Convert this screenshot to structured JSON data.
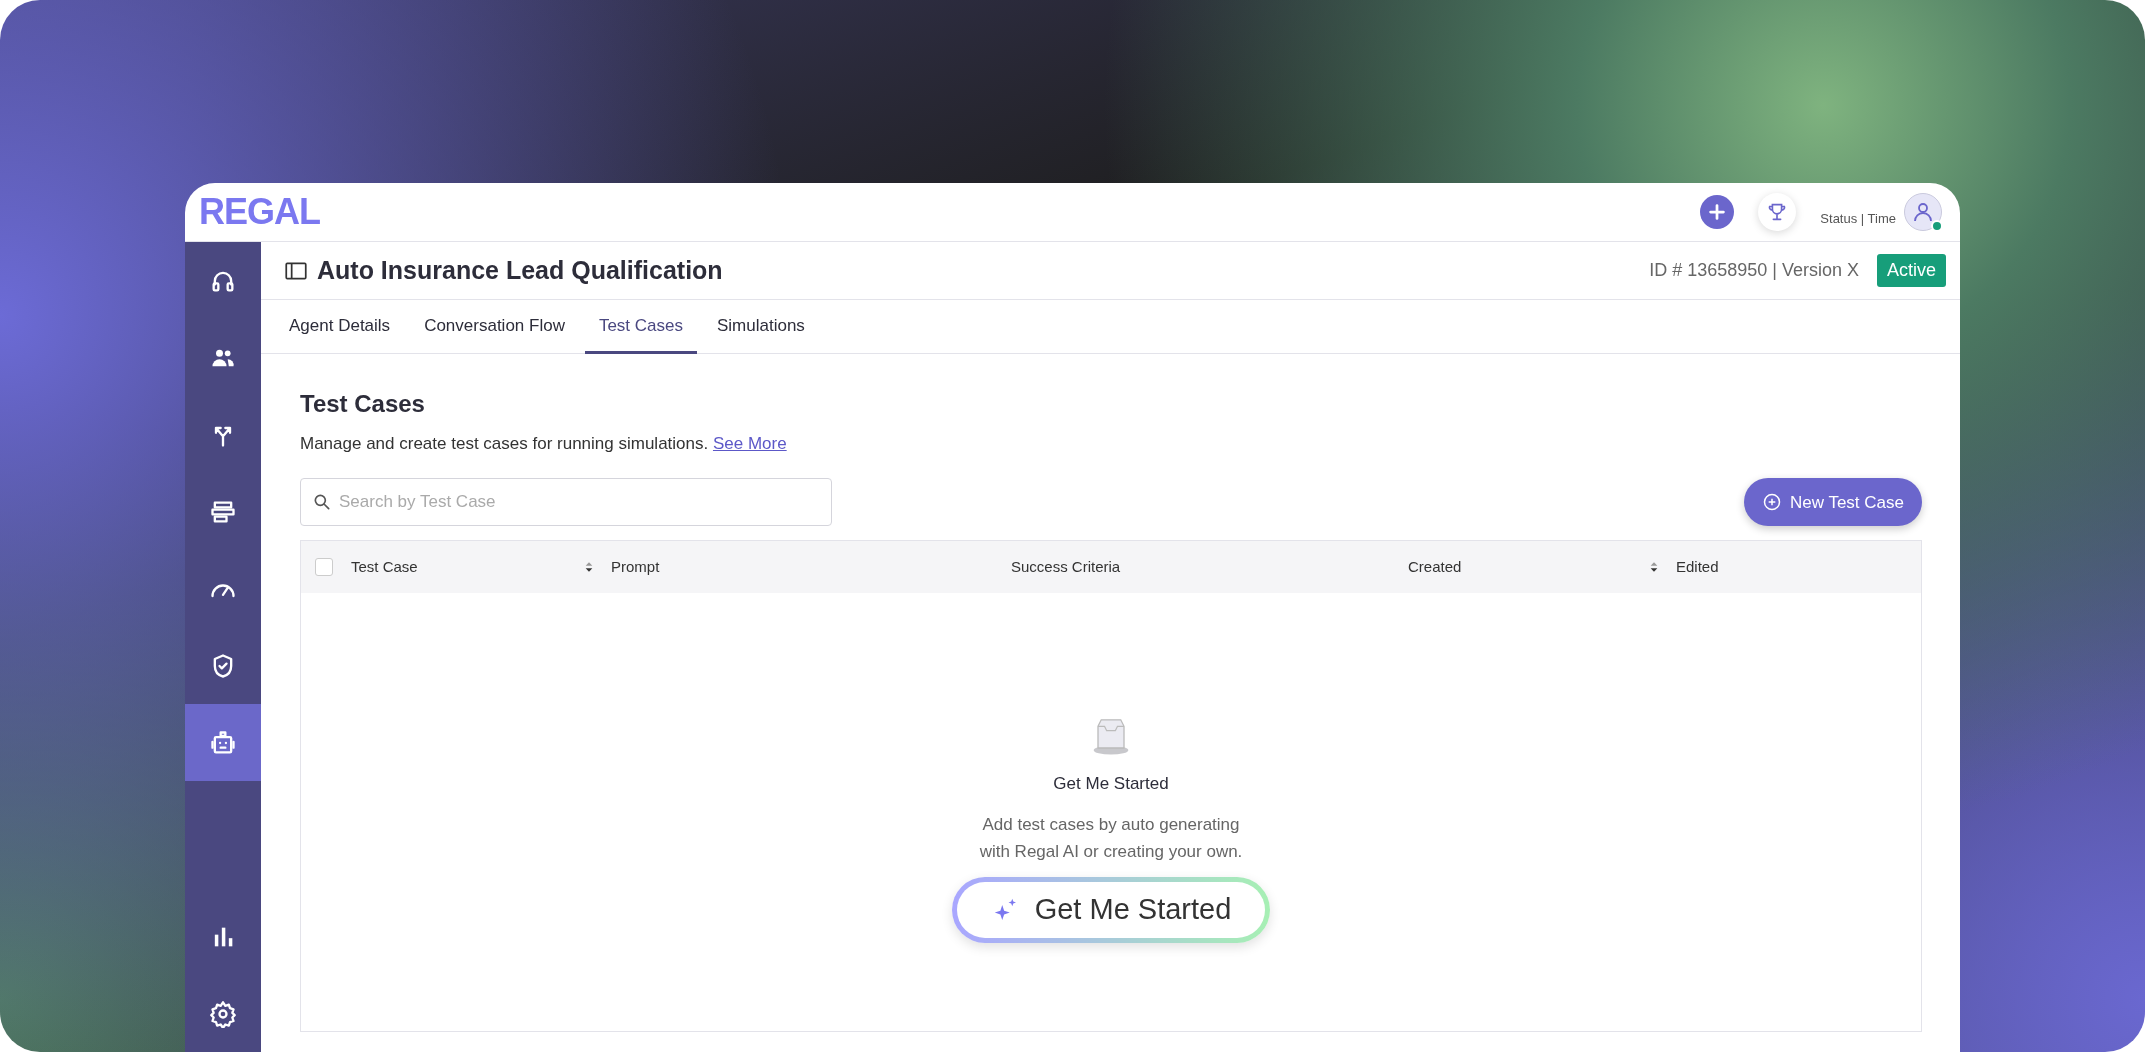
{
  "logo": "REGAL",
  "top_bar": {
    "status_text": "Status | Time"
  },
  "sidebar": {
    "items": [
      {
        "selected": false
      },
      {
        "selected": false
      },
      {
        "selected": false
      },
      {
        "selected": false
      },
      {
        "selected": false
      },
      {
        "selected": false
      },
      {
        "selected": true
      }
    ],
    "bottom_items": [
      {
        "selected": false
      },
      {
        "selected": false
      }
    ]
  },
  "header": {
    "title": "Auto Insurance Lead Qualification",
    "meta": "ID # 13658950 | Version X",
    "status_badge": "Active"
  },
  "tabs": [
    {
      "label": "Agent Details",
      "selected": false
    },
    {
      "label": "Conversation Flow",
      "selected": false
    },
    {
      "label": "Test Cases",
      "selected": true
    },
    {
      "label": "Simulations",
      "selected": false
    }
  ],
  "section": {
    "title": "Test Cases",
    "description": "Manage and create test cases for running simulations.",
    "link": "See More"
  },
  "search": {
    "placeholder": "Search by Test Case"
  },
  "new_button": "New Test Case",
  "table": {
    "select_all_checked": false,
    "columns": [
      {
        "label": "Test Case",
        "sortable": true
      },
      {
        "label": "Prompt",
        "sortable": false
      },
      {
        "label": "Success Criteria",
        "sortable": false
      },
      {
        "label": "Created",
        "sortable": true
      },
      {
        "label": "Edited",
        "sortable": false
      }
    ]
  },
  "empty_state": {
    "title": "Get Me Started",
    "text": "Add test cases by auto generating with Regal AI or creating your own.",
    "button": "Get Me Started"
  }
}
